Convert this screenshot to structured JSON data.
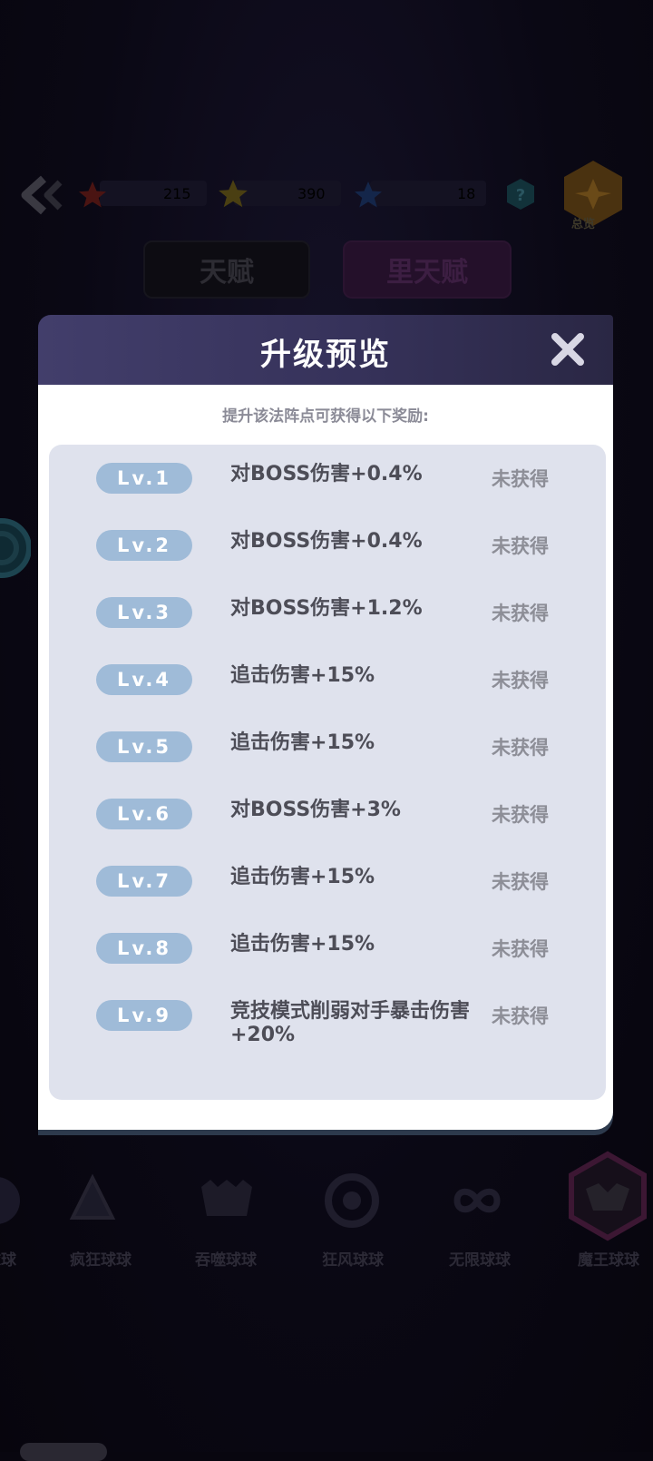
{
  "topbar": {
    "red_star_count": "215",
    "gold_star_count": "390",
    "blue_star_count": "18",
    "summary_label": "总览"
  },
  "tabs": {
    "talent": "天赋",
    "inner_talent": "里天赋"
  },
  "modal": {
    "title": "升级预览",
    "subtitle": "提升该法阵点可获得以下奖励:",
    "rewards": [
      {
        "level": "Lv.1",
        "desc": "对BOSS伤害+0.4%",
        "status": "未获得"
      },
      {
        "level": "Lv.2",
        "desc": "对BOSS伤害+0.4%",
        "status": "未获得"
      },
      {
        "level": "Lv.3",
        "desc": "对BOSS伤害+1.2%",
        "status": "未获得"
      },
      {
        "level": "Lv.4",
        "desc": "追击伤害+15%",
        "status": "未获得"
      },
      {
        "level": "Lv.5",
        "desc": "追击伤害+15%",
        "status": "未获得"
      },
      {
        "level": "Lv.6",
        "desc": "对BOSS伤害+3%",
        "status": "未获得"
      },
      {
        "level": "Lv.7",
        "desc": "追击伤害+15%",
        "status": "未获得"
      },
      {
        "level": "Lv.8",
        "desc": "追击伤害+15%",
        "status": "未获得"
      },
      {
        "level": "Lv.9",
        "desc": "竞技模式削弱对手暴击伤害+20%",
        "status": "未获得"
      }
    ]
  },
  "balls": [
    {
      "label": "球球"
    },
    {
      "label": "疯狂球球"
    },
    {
      "label": "吞噬球球"
    },
    {
      "label": "狂风球球"
    },
    {
      "label": "无限球球"
    },
    {
      "label": "魔王球球"
    }
  ],
  "colors": {
    "header_bg": "#423e6b",
    "level_pill": "#9fbbd8",
    "panel_bg": "#dfe2ed"
  }
}
